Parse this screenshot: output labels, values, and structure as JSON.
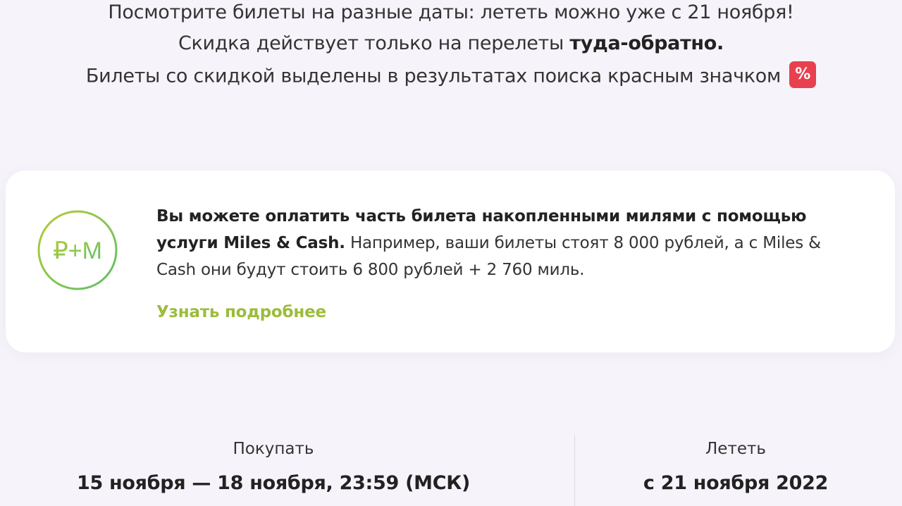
{
  "intro": {
    "line1": "Посмотрите билеты на разные даты: лететь можно уже с 21 ноября!",
    "line2_prefix": "Скидка действует только на перелеты ",
    "line2_bold": "туда-обратно.",
    "line3_text": "Билеты со скидкой выделены в результатах поиска красным значком",
    "badge_symbol": "%"
  },
  "miles_card": {
    "logo_text": "₽+M",
    "bold_text": "Вы можете оплатить часть билета накопленными милями с помощью услуги Miles & Cash.",
    "regular_text": " Например, ваши билеты стоят 8 000 рублей, а с Miles & Cash они будут стоить 6 800 рублей + 2 760 миль.",
    "link_label": "Узнать подробнее"
  },
  "buy_period": {
    "label": "Покупать",
    "value": "15 ноября — 18 ноября, 23:59 (МСК)"
  },
  "fly_period": {
    "label": "Лететь",
    "value": "с 21 ноября 2022"
  },
  "colors": {
    "background": "#f6f4fa",
    "badge_red": "#e8404f",
    "accent_green": "#9cbc3c"
  }
}
